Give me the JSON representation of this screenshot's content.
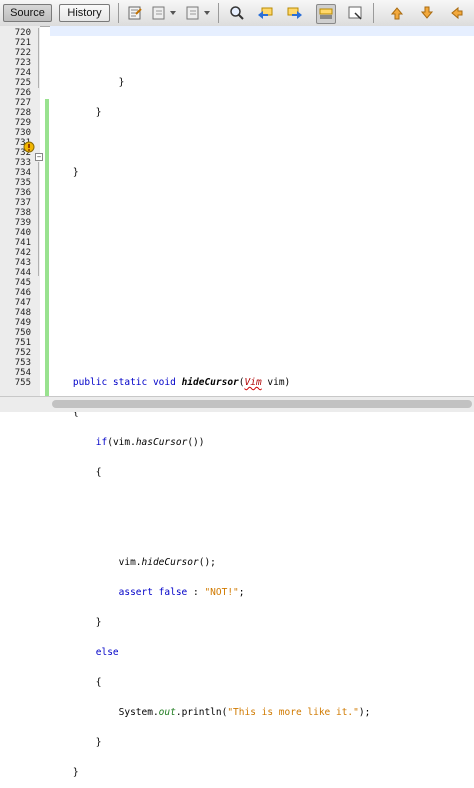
{
  "toolbar": {
    "source_label": "Source",
    "history_label": "History",
    "icons": [
      "last-edit-icon",
      "back-icon",
      "forward-icon",
      "find-icon",
      "find-previous-icon",
      "find-next-icon",
      "toggle-highlight-icon",
      "toggle-rectangular-selection-icon",
      "previous-bookmark-icon",
      "next-bookmark-icon",
      "toggle-bookmark-icon"
    ]
  },
  "editor": {
    "line_numbers": [
      "720",
      "721",
      "722",
      "723",
      "724",
      "725",
      "726",
      "727",
      "728",
      "729",
      "730",
      "731",
      "732",
      "733",
      "734",
      "735",
      "736",
      "737",
      "738",
      "739",
      "740",
      "741",
      "742",
      "743",
      "744",
      "745",
      "746",
      "747",
      "748",
      "749",
      "750",
      "751",
      "752",
      "753",
      "754",
      "755"
    ],
    "code": {
      "l721": "            }",
      "l722": "        }",
      "l724": "    }",
      "l731_kw": "public static void ",
      "l731_method": "hideCursor",
      "l731_paren": "(",
      "l731_type": "Vim",
      "l731_rest": " vim)",
      "l732": "    {",
      "l733_if": "if",
      "l733_mid": "(vim.",
      "l733_method": "hasCursor",
      "l733_end": "())",
      "l734": "        {",
      "l737_pre": "            vim.",
      "l737_method": "hideCursor",
      "l737_end": "();",
      "l738_kw": "assert false",
      "l738_mid": " : ",
      "l738_str": "\"NOT!\"",
      "l738_end": ";",
      "l739": "        }",
      "l740_kw": "else",
      "l741": "        {",
      "l742_pre": "            System.",
      "l742_fld": "out",
      "l742_mid": ".println(",
      "l742_str": "\"This is more like it.\"",
      "l742_end": ");",
      "l743": "        }",
      "l744": "    }"
    }
  },
  "colors": {
    "keyword": "#0000c8",
    "string": "#d07a00",
    "static_field": "#1e7b1e",
    "error": "#b00000",
    "change_bar": "#99e28f"
  }
}
